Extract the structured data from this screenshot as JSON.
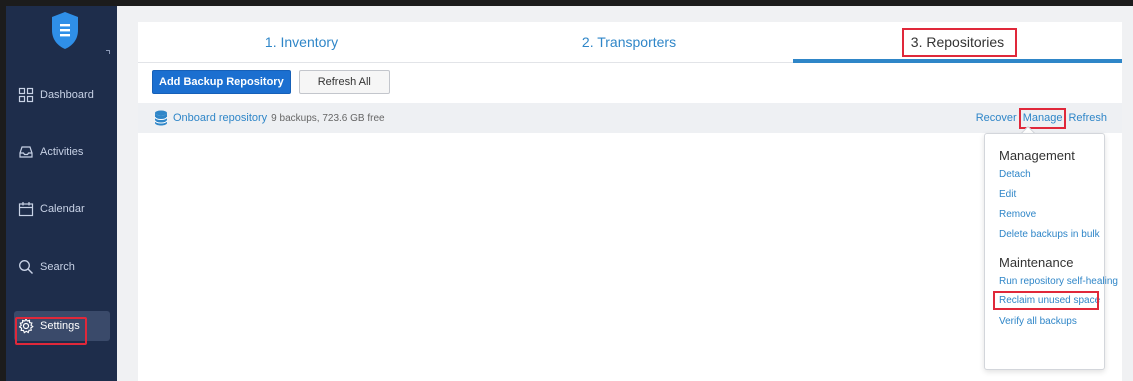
{
  "sidebar": {
    "items": [
      {
        "label": "Dashboard",
        "icon": "dashboard-icon"
      },
      {
        "label": "Activities",
        "icon": "activities-icon"
      },
      {
        "label": "Calendar",
        "icon": "calendar-icon"
      },
      {
        "label": "Search",
        "icon": "search-icon"
      },
      {
        "label": "Settings",
        "icon": "settings-icon",
        "active": true
      }
    ]
  },
  "tabs": [
    {
      "label": "1. Inventory"
    },
    {
      "label": "2. Transporters"
    },
    {
      "label": "3. Repositories",
      "active": true
    }
  ],
  "toolbar": {
    "add_label": "Add Backup Repository",
    "refresh_all_label": "Refresh All"
  },
  "repository": {
    "name": "Onboard repository",
    "info": "9 backups, 723.6 GB free",
    "actions": {
      "recover": "Recover",
      "manage": "Manage",
      "refresh": "Refresh"
    }
  },
  "manage_menu": {
    "management_heading": "Management",
    "management_items": [
      "Detach",
      "Edit",
      "Remove",
      "Delete backups in bulk"
    ],
    "maintenance_heading": "Maintenance",
    "maintenance_items": [
      "Run repository self-healing",
      "Reclaim unused space",
      "Verify all backups"
    ]
  },
  "colors": {
    "sidebar_bg": "#1e2d4b",
    "accent": "#2f86c8",
    "primary_button": "#1b6fd0",
    "highlight": "#e0283a"
  }
}
